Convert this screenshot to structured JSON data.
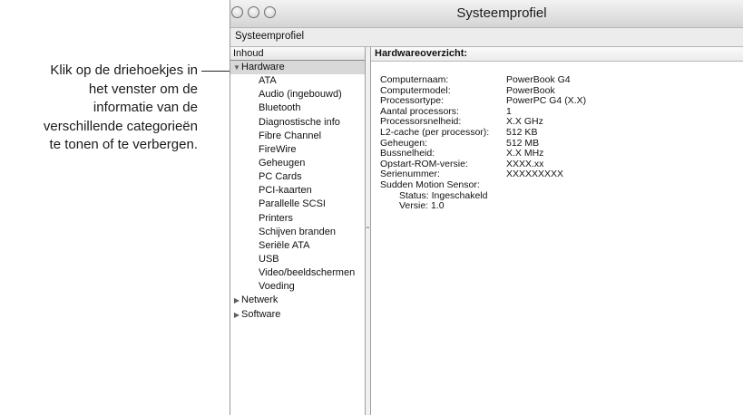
{
  "callout": {
    "lines": [
      "Klik op de driehoekjes in",
      "het venster om de",
      "informatie van de",
      "verschillende categorieën",
      "te tonen of te verbergen."
    ]
  },
  "window": {
    "title": "Systeemprofiel",
    "toolbar_label": "Systeemprofiel"
  },
  "sidebar": {
    "header": "Inhoud",
    "hardware": {
      "label": "Hardware",
      "icon": "triangle-down-icon"
    },
    "hardware_items": [
      "ATA",
      "Audio (ingebouwd)",
      "Bluetooth",
      "Diagnostische info",
      "Fibre Channel",
      "FireWire",
      "Geheugen",
      "PC Cards",
      "PCI-kaarten",
      "Parallelle SCSI",
      "Printers",
      "Schijven branden",
      "Seriële ATA",
      "USB",
      "Video/beeldschermen",
      "Voeding"
    ],
    "netwerk": {
      "label": "Netwerk",
      "icon": "triangle-right-icon"
    },
    "software": {
      "label": "Software",
      "icon": "triangle-right-icon"
    }
  },
  "detail": {
    "header": "Hardwareoverzicht:",
    "rows": [
      {
        "key": "Computernaam:",
        "value": "PowerBook G4"
      },
      {
        "key": "Computermodel:",
        "value": "PowerBook"
      },
      {
        "key": "Processortype:",
        "value": "PowerPC G4 (X.X)"
      },
      {
        "key": "Aantal processors:",
        "value": "1"
      },
      {
        "key": "Processorsnelheid:",
        "value": "X.X GHz"
      },
      {
        "key": "L2-cache (per processor):",
        "value": "512 KB"
      },
      {
        "key": "Geheugen:",
        "value": "512 MB"
      },
      {
        "key": "Bussnelheid:",
        "value": "X.X MHz"
      },
      {
        "key": "Opstart-ROM-versie:",
        "value": "XXXX.xx"
      },
      {
        "key": "Serienummer:",
        "value": "XXXXXXXXX"
      }
    ],
    "sms_label": "Sudden Motion Sensor:",
    "sms_status": "Status:  Ingeschakeld",
    "sms_version": "Versie:  1.0"
  }
}
